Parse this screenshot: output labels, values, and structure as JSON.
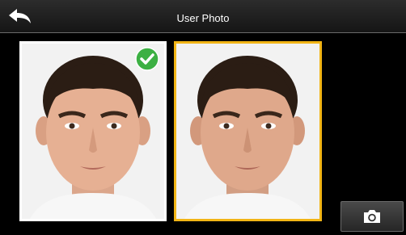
{
  "header": {
    "title": "User Photo",
    "back_icon": "back-arrow-icon"
  },
  "photos": [
    {
      "selected": true,
      "badge_icon": "check-circle-icon",
      "border_color": "#ffffff"
    },
    {
      "selected": false,
      "border_color": "#f2b516"
    }
  ],
  "camera_button": {
    "icon": "camera-icon"
  },
  "colors": {
    "background": "#000000",
    "accent": "#f2b516",
    "check": "#3cb043"
  }
}
